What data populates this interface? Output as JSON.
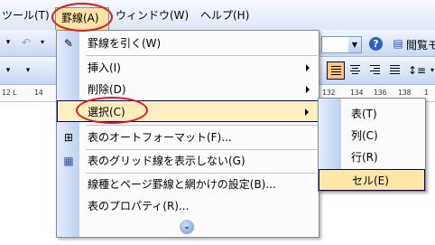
{
  "menubar": {
    "items": [
      {
        "label": "ツール(T)"
      },
      {
        "label": "罫線(A)"
      },
      {
        "label": "ウィンドウ(W)"
      },
      {
        "label": "ヘルプ(H)"
      }
    ]
  },
  "toolbar": {
    "help_symbol": "?",
    "reading_layout_label": "閲覧モ"
  },
  "ruler": {
    "marks": [
      "12",
      "L",
      "14",
      "132",
      "134",
      "136",
      "138",
      "1"
    ]
  },
  "table_menu": {
    "items": [
      {
        "label": "罫線を引く(W)",
        "icon": "draw-table-icon",
        "submenu": false
      },
      {
        "label": "挿入(I)",
        "submenu": true
      },
      {
        "label": "削除(D)",
        "submenu": true
      },
      {
        "label": "選択(C)",
        "submenu": true,
        "highlighted": true
      },
      {
        "label": "表のオートフォーマット(F)...",
        "icon": "table-autoformat-icon"
      },
      {
        "label": "表のグリッド線を表示しない(G)",
        "icon": "gridlines-icon"
      },
      {
        "label": "線種とページ罫線と網かけの設定(B)..."
      },
      {
        "label": "表のプロパティ(R)..."
      }
    ],
    "expand_symbol": "⌄"
  },
  "select_submenu": {
    "items": [
      {
        "label": "表(T)"
      },
      {
        "label": "列(C)"
      },
      {
        "label": "行(R)"
      },
      {
        "label": "セル(E)",
        "selected": true
      }
    ]
  },
  "colors": {
    "highlight": "#ffeec2",
    "annotation_red": "#e0161b"
  }
}
